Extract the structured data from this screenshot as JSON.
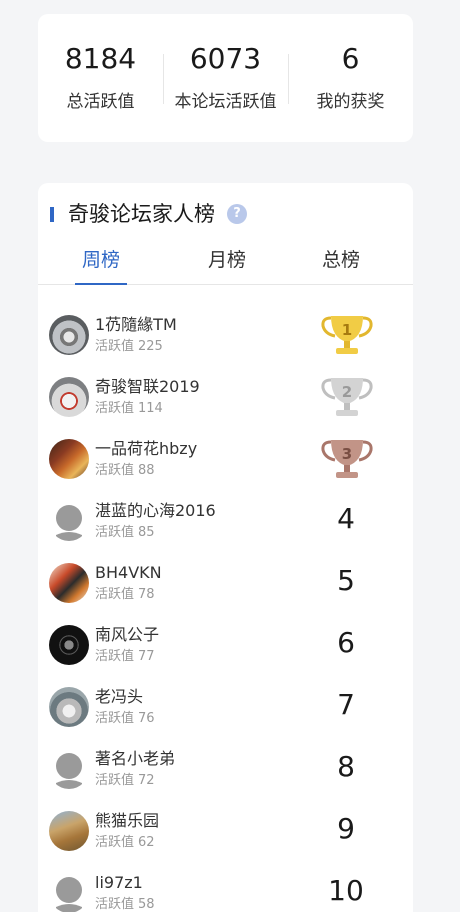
{
  "stats": [
    {
      "value": "8184",
      "label": "总活跃值"
    },
    {
      "value": "6073",
      "label": "本论坛活跃值"
    },
    {
      "value": "6",
      "label": "我的获奖"
    }
  ],
  "ranking": {
    "title": "奇骏论坛家人榜",
    "help_icon": "?",
    "tabs": [
      {
        "label": "周榜",
        "active": true
      },
      {
        "label": "月榜",
        "active": false
      },
      {
        "label": "总榜",
        "active": false
      }
    ],
    "activity_label": "活跃值",
    "rows": [
      {
        "name": "1芿隨緣TM",
        "activity": "225",
        "rank": "1",
        "badge": "gold-trophy-icon",
        "avatar": "car-avatar"
      },
      {
        "name": "奇骏智联2019",
        "activity": "114",
        "rank": "2",
        "badge": "silver-trophy-icon",
        "avatar": "car-avatar"
      },
      {
        "name": "一品荷花hbzy",
        "activity": "88",
        "rank": "3",
        "badge": "bronze-trophy-icon",
        "avatar": "photo-avatar"
      },
      {
        "name": "湛蓝的心海2016",
        "activity": "85",
        "rank": "4",
        "avatar": "default-avatar"
      },
      {
        "name": "BH4VKN",
        "activity": "78",
        "rank": "5",
        "avatar": "photo-avatar"
      },
      {
        "name": "南风公子",
        "activity": "77",
        "rank": "6",
        "avatar": "logo-avatar"
      },
      {
        "name": "老冯头",
        "activity": "76",
        "rank": "7",
        "avatar": "car-avatar"
      },
      {
        "name": "著名小老弟",
        "activity": "72",
        "rank": "8",
        "avatar": "default-avatar"
      },
      {
        "name": "熊猫乐园",
        "activity": "62",
        "rank": "9",
        "avatar": "photo-avatar"
      },
      {
        "name": "li97z1",
        "activity": "58",
        "rank": "10",
        "avatar": "default-avatar"
      }
    ]
  },
  "colors": {
    "accent": "#2f67c5",
    "gold": "#e9c23a",
    "silver": "#c8c8c8",
    "bronze": "#b8877a"
  }
}
